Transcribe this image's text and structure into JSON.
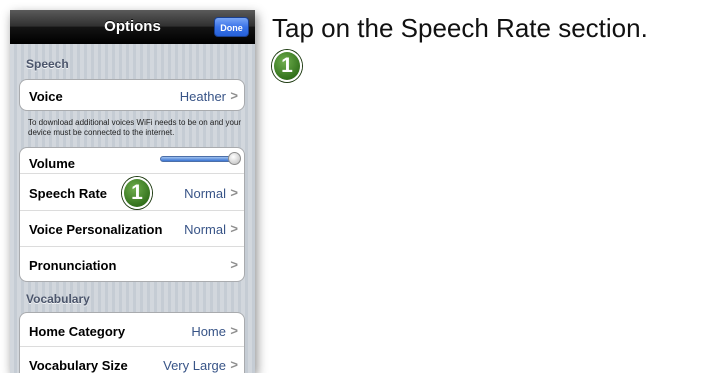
{
  "nav": {
    "title": "Options",
    "done_label": "Done"
  },
  "sections": {
    "speech_header": "Speech",
    "vocabulary_header": "Vocabulary"
  },
  "rows": {
    "voice": {
      "label": "Voice",
      "value": "Heather"
    },
    "voice_note": "To download additional voices WiFi needs to be on and your device must be connected to the internet.",
    "volume": {
      "label": "Volume",
      "level": 1.0
    },
    "speech_rate": {
      "label": "Speech Rate",
      "value": "Normal"
    },
    "voice_personalization": {
      "label": "Voice Personalization",
      "value": "Normal"
    },
    "pronunciation": {
      "label": "Pronunciation"
    },
    "home_category": {
      "label": "Home Category",
      "value": "Home"
    },
    "vocabulary_size": {
      "label": "Vocabulary Size",
      "value": "Very Large"
    }
  },
  "chevron": ">",
  "badge_text": "1",
  "instruction": "Tap on the Speech Rate section.",
  "colors": {
    "value_blue": "#385487",
    "badge_green": "#34731d",
    "done_blue": "#3a73e9"
  }
}
